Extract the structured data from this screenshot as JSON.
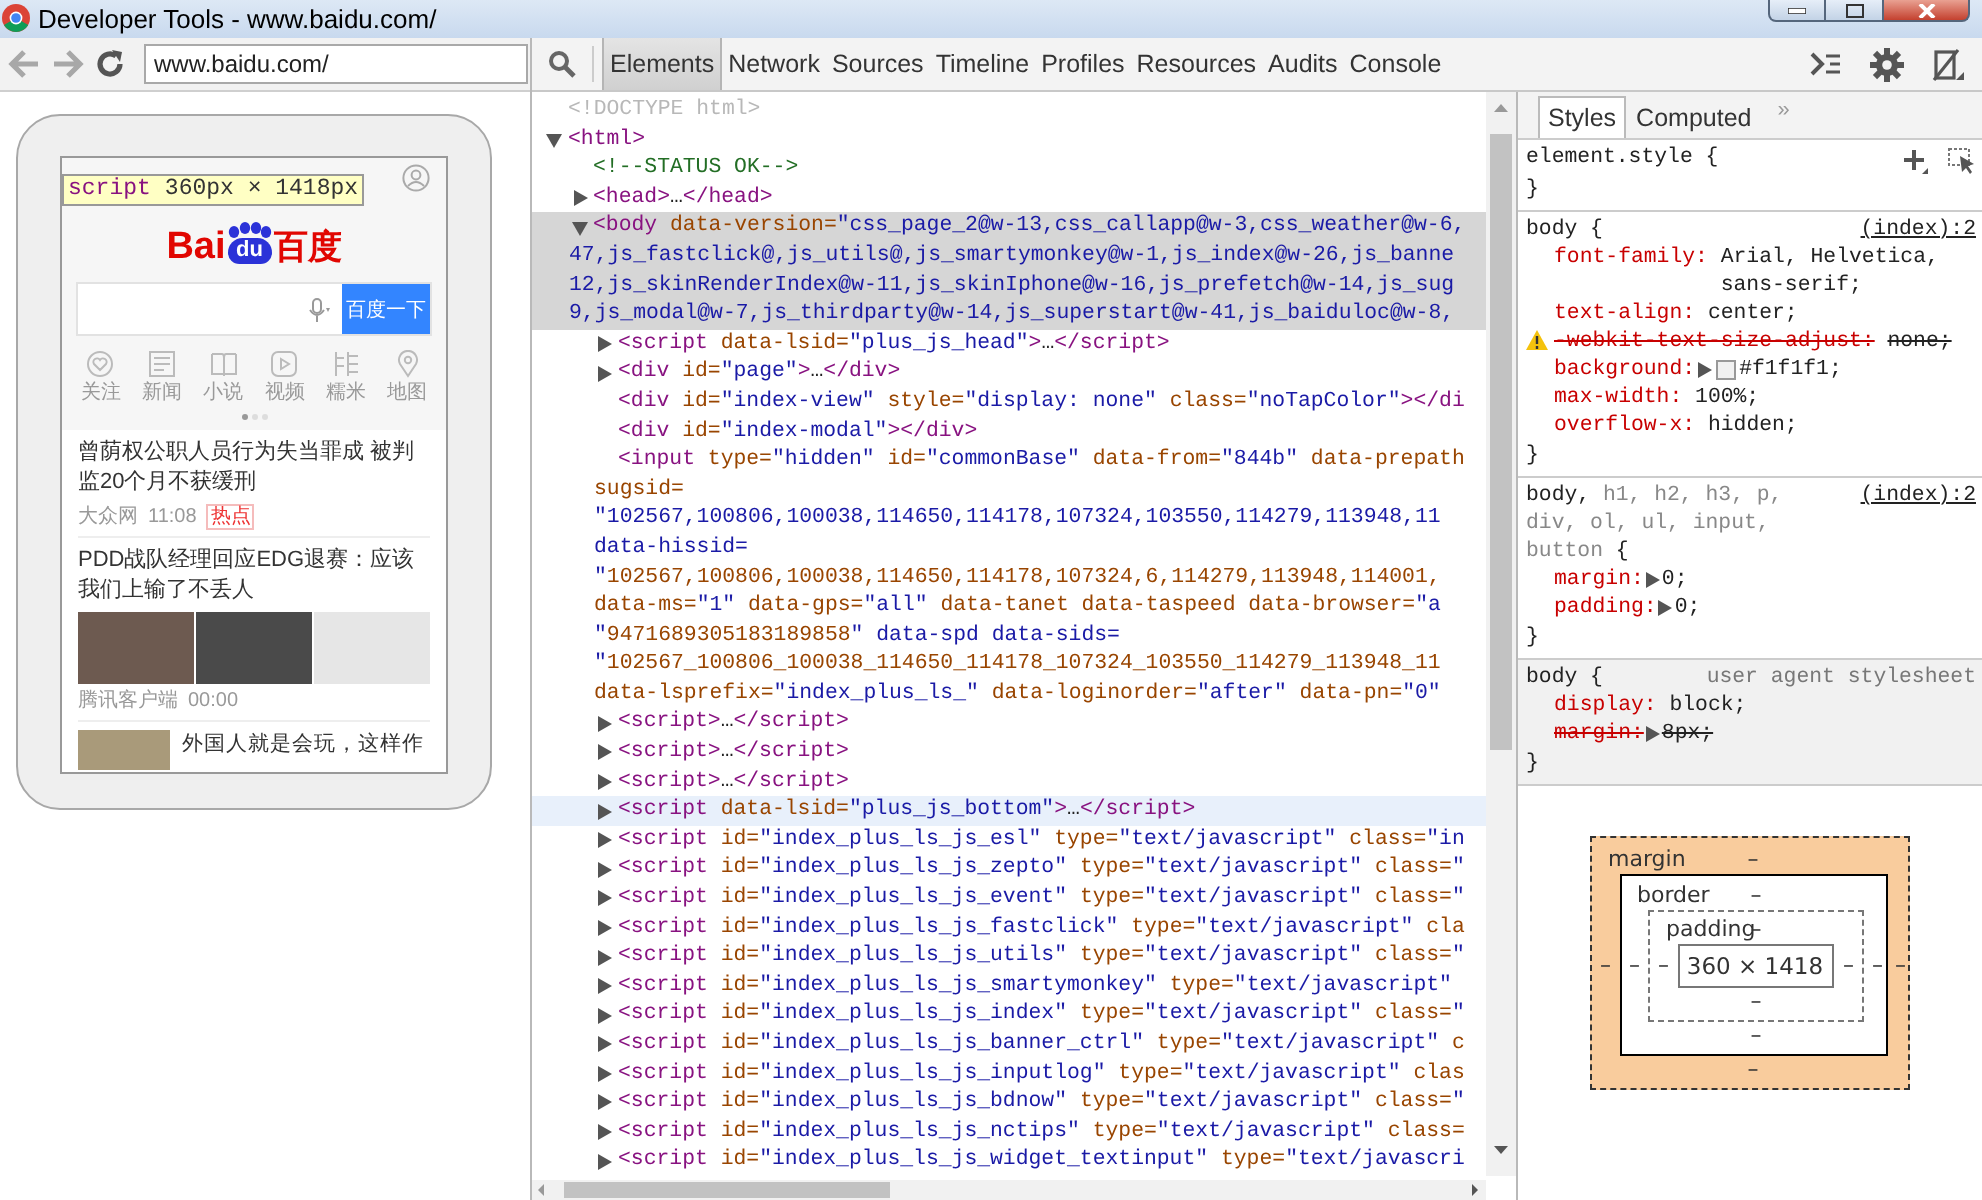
{
  "window": {
    "title": "Developer Tools - www.baidu.com/"
  },
  "browser": {
    "url": "www.baidu.com/"
  },
  "device": {
    "tooltip": {
      "tag": "script",
      "size": "360px × 1418px"
    },
    "page": {
      "logo": {
        "left": "Bai",
        "badge": "du",
        "right": "百度"
      },
      "search_button": "百度一下",
      "nav": [
        {
          "label": "关注"
        },
        {
          "label": "新闻"
        },
        {
          "label": "小说"
        },
        {
          "label": "视频"
        },
        {
          "label": "糯米"
        },
        {
          "label": "地图"
        }
      ],
      "dots": [
        {
          "selected": true
        },
        {
          "selected": false
        },
        {
          "selected": false
        }
      ],
      "news": [
        {
          "kind": "text",
          "title": "曾荫权公职人员行为失当罪成 被判监20个月不获缓刑",
          "source": "大众网",
          "time": "11:08",
          "tag": "热点"
        },
        {
          "kind": "gallery",
          "title": "PDD战队经理回应EDG退赛：应该我们上输了不丢人",
          "source": "腾讯客户端",
          "time": "00:00"
        },
        {
          "kind": "thumb",
          "title": "外国人就是会玩，这样作"
        }
      ]
    }
  },
  "devtools": {
    "tabs": [
      {
        "label": "Elements",
        "selected": true
      },
      {
        "label": "Network",
        "selected": false
      },
      {
        "label": "Sources",
        "selected": false
      },
      {
        "label": "Timeline",
        "selected": false
      },
      {
        "label": "Profiles",
        "selected": false
      },
      {
        "label": "Resources",
        "selected": false
      },
      {
        "label": "Audits",
        "selected": false
      },
      {
        "label": "Console",
        "selected": false
      }
    ]
  },
  "dom_tree": [
    {
      "kind": "doctype",
      "expandable": false,
      "selected": false,
      "hovered": false,
      "lines": [
        "<!DOCTYPE html>"
      ]
    },
    {
      "kind": "element",
      "expandable": true,
      "expanded": true,
      "selected": false,
      "hovered": false,
      "lines": [
        "<html>"
      ],
      "children": [
        {
          "kind": "comment",
          "expandable": false,
          "selected": false,
          "hovered": false,
          "lines": [
            "<!--STATUS OK-->"
          ]
        },
        {
          "kind": "element",
          "expandable": true,
          "expanded": false,
          "selected": false,
          "hovered": false,
          "lines": [
            "<head>…</head>"
          ]
        },
        {
          "kind": "element",
          "expandable": true,
          "expanded": true,
          "selected": true,
          "hovered": false,
          "lines": [
            "<body data-version=\"css_page_2@w-13,css_callapp@w-3,css_weather@w-6,",
            "47,js_fastclick@,js_utils@,js_smartymonkey@w-1,js_index@w-26,js_banne",
            "12,js_skinRenderIndex@w-11,js_skinIphone@w-16,js_prefetch@w-14,js_sug",
            "9,js_modal@w-7,js_thirdparty@w-14,js_superstart@w-41,js_baiduloc@w-8,"
          ],
          "children": [
            {
              "kind": "element",
              "expandable": true,
              "expanded": false,
              "selected": false,
              "hovered": false,
              "lines": [
                "<script data-lsid=\"plus_js_head\">…</script>"
              ]
            },
            {
              "kind": "element",
              "expandable": true,
              "expanded": false,
              "selected": false,
              "hovered": false,
              "lines": [
                "<div id=\"page\">…</div>"
              ]
            },
            {
              "kind": "element",
              "expandable": false,
              "selected": false,
              "hovered": false,
              "lines": [
                "<div id=\"index-view\" style=\"display: none\" class=\"noTapColor\"></di"
              ]
            },
            {
              "kind": "element",
              "expandable": false,
              "selected": false,
              "hovered": false,
              "lines": [
                "<div id=\"index-modal\"></div>"
              ]
            },
            {
              "kind": "element",
              "expandable": false,
              "selected": false,
              "hovered": false,
              "lines": [
                "<input type=\"hidden\" id=\"commonBase\" data-from=\"844b\" data-prepath",
                "sugsid=",
                "\"102567,100806,100038,114650,114178,107324,103550,114279,113948,11",
                "data-hissid=",
                "\"102567,100806,100038,114650,114178,107324,6,114279,113948,114001,",
                "data-ms=\"1\" data-gps=\"all\" data-tanet data-taspeed data-browser=\"a",
                "\"9471689305183189858\" data-spd data-sids=",
                "\"102567_100806_100038_114650_114178_107324_103550_114279_113948_11",
                "data-lsprefix=\"index_plus_ls_\" data-loginorder=\"after\" data-pn=\"0\""
              ]
            },
            {
              "kind": "element",
              "expandable": true,
              "expanded": false,
              "selected": false,
              "hovered": false,
              "lines": [
                "<script>…</script>"
              ]
            },
            {
              "kind": "element",
              "expandable": true,
              "expanded": false,
              "selected": false,
              "hovered": false,
              "lines": [
                "<script>…</script>"
              ]
            },
            {
              "kind": "element",
              "expandable": true,
              "expanded": false,
              "selected": false,
              "hovered": false,
              "lines": [
                "<script>…</script>"
              ]
            },
            {
              "kind": "element",
              "expandable": true,
              "expanded": false,
              "selected": false,
              "hovered": true,
              "lines": [
                "<script data-lsid=\"plus_js_bottom\">…</script>"
              ]
            },
            {
              "kind": "element",
              "expandable": true,
              "expanded": false,
              "selected": false,
              "hovered": false,
              "lines": [
                "<script id=\"index_plus_ls_js_esl\" type=\"text/javascript\" class=\"in"
              ]
            },
            {
              "kind": "element",
              "expandable": true,
              "expanded": false,
              "selected": false,
              "hovered": false,
              "lines": [
                "<script id=\"index_plus_ls_js_zepto\" type=\"text/javascript\" class=\""
              ]
            },
            {
              "kind": "element",
              "expandable": true,
              "expanded": false,
              "selected": false,
              "hovered": false,
              "lines": [
                "<script id=\"index_plus_ls_js_event\" type=\"text/javascript\" class=\""
              ]
            },
            {
              "kind": "element",
              "expandable": true,
              "expanded": false,
              "selected": false,
              "hovered": false,
              "lines": [
                "<script id=\"index_plus_ls_js_fastclick\" type=\"text/javascript\" cla"
              ]
            },
            {
              "kind": "element",
              "expandable": true,
              "expanded": false,
              "selected": false,
              "hovered": false,
              "lines": [
                "<script id=\"index_plus_ls_js_utils\" type=\"text/javascript\" class=\""
              ]
            },
            {
              "kind": "element",
              "expandable": true,
              "expanded": false,
              "selected": false,
              "hovered": false,
              "lines": [
                "<script id=\"index_plus_ls_js_smartymonkey\" type=\"text/javascript\""
              ]
            },
            {
              "kind": "element",
              "expandable": true,
              "expanded": false,
              "selected": false,
              "hovered": false,
              "lines": [
                "<script id=\"index_plus_ls_js_index\" type=\"text/javascript\" class=\""
              ]
            },
            {
              "kind": "element",
              "expandable": true,
              "expanded": false,
              "selected": false,
              "hovered": false,
              "lines": [
                "<script id=\"index_plus_ls_js_banner_ctrl\" type=\"text/javascript\" c"
              ]
            },
            {
              "kind": "element",
              "expandable": true,
              "expanded": false,
              "selected": false,
              "hovered": false,
              "lines": [
                "<script id=\"index_plus_ls_js_inputlog\" type=\"text/javascript\" clas"
              ]
            },
            {
              "kind": "element",
              "expandable": true,
              "expanded": false,
              "selected": false,
              "hovered": false,
              "lines": [
                "<script id=\"index_plus_ls_js_bdnow\" type=\"text/javascript\" class=\""
              ]
            },
            {
              "kind": "element",
              "expandable": true,
              "expanded": false,
              "selected": false,
              "hovered": false,
              "lines": [
                "<script id=\"index_plus_ls_js_nctips\" type=\"text/javascript\" class="
              ]
            },
            {
              "kind": "element",
              "expandable": true,
              "expanded": false,
              "selected": false,
              "hovered": false,
              "lines": [
                "<script id=\"index_plus_ls_js_widget_textinput\" type=\"text/javascri"
              ]
            }
          ]
        }
      ]
    }
  ],
  "styles": {
    "tabs": [
      {
        "label": "Styles",
        "selected": true
      },
      {
        "label": "Computed",
        "selected": false
      }
    ],
    "more": "»",
    "rules": [
      {
        "kind": "inline",
        "selectors": [
          {
            "text": "element.style",
            "matched": true
          }
        ],
        "open": "{",
        "close": "}"
      },
      {
        "kind": "author",
        "selectors": [
          {
            "text": "body",
            "matched": true
          }
        ],
        "open": "{",
        "close": "}",
        "source": "(index):2",
        "properties": [
          {
            "name": "font-family:",
            "value": "Arial, Helvetica, sans-serif;",
            "overridden": false,
            "warning": false,
            "expandable": false
          },
          {
            "name": "text-align:",
            "value": "center;",
            "overridden": false,
            "warning": false,
            "expandable": false
          },
          {
            "name": "-webkit-text-size-adjust:",
            "value": "none;",
            "overridden": true,
            "warning": true,
            "expandable": false
          },
          {
            "name": "background:",
            "value": "#f1f1f1;",
            "color": "#f1f1f1",
            "overridden": false,
            "warning": false,
            "expandable": true
          },
          {
            "name": "max-width:",
            "value": "100%;",
            "overridden": false,
            "warning": false,
            "expandable": false
          },
          {
            "name": "overflow-x:",
            "value": "hidden;",
            "overridden": false,
            "warning": false,
            "expandable": false
          }
        ]
      },
      {
        "kind": "author",
        "selectors": [
          {
            "text": "body,",
            "matched": true
          },
          {
            "text": "h1,",
            "matched": false
          },
          {
            "text": "h2,",
            "matched": false
          },
          {
            "text": "h3,",
            "matched": false
          },
          {
            "text": "p,",
            "matched": false
          },
          {
            "text": "div,",
            "matched": false
          },
          {
            "text": "ol,",
            "matched": false
          },
          {
            "text": "ul,",
            "matched": false
          },
          {
            "text": "input,",
            "matched": false
          },
          {
            "text": "button",
            "matched": false
          }
        ],
        "open": "{",
        "close": "}",
        "source": "(index):2",
        "properties": [
          {
            "name": "margin:",
            "value": "0;",
            "overridden": false,
            "warning": false,
            "expandable": true
          },
          {
            "name": "padding:",
            "value": "0;",
            "overridden": false,
            "warning": false,
            "expandable": true
          }
        ]
      },
      {
        "kind": "user_agent",
        "selectors": [
          {
            "text": "body",
            "matched": true
          }
        ],
        "open": "{",
        "close": "}",
        "source": "user agent stylesheet",
        "properties": [
          {
            "name": "display:",
            "value": "block;",
            "overridden": false,
            "warning": false,
            "expandable": false
          },
          {
            "name": "margin:",
            "value": "8px;",
            "overridden": true,
            "warning": false,
            "expandable": true
          }
        ]
      }
    ]
  },
  "box_model": {
    "margin": {
      "label": "margin",
      "top": "–",
      "right": "–",
      "bottom": "–",
      "left": "–"
    },
    "border": {
      "label": "border",
      "top": "–",
      "right": "–",
      "bottom": "–",
      "left": "–"
    },
    "padding": {
      "label": "padding",
      "top": "–",
      "right": "–",
      "bottom": "–",
      "left": "–"
    },
    "content": "360 × 1418"
  }
}
